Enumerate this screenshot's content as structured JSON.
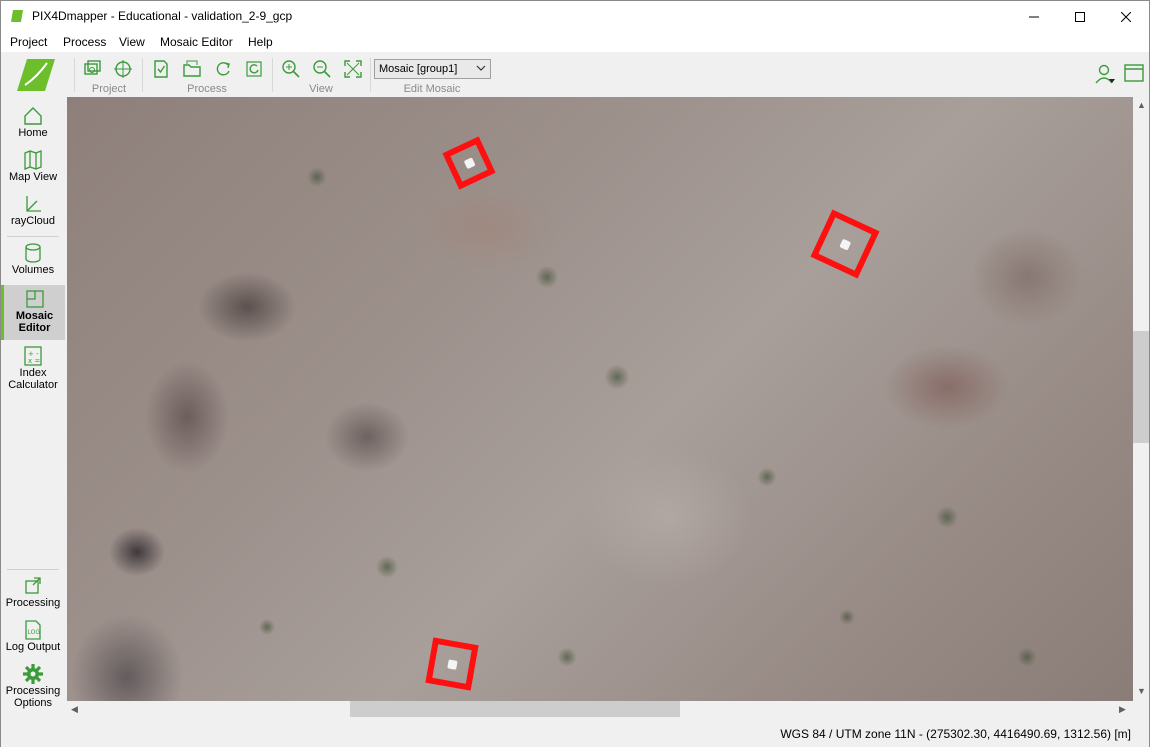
{
  "window": {
    "title": "PIX4Dmapper - Educational - validation_2-9_gcp",
    "brand_color": "#6cbf2a"
  },
  "menu": {
    "items": [
      {
        "label": "Project"
      },
      {
        "label": "Process"
      },
      {
        "label": "View"
      },
      {
        "label": "Mosaic Editor"
      },
      {
        "label": "Help"
      }
    ]
  },
  "toolbar": {
    "groups": [
      {
        "label": "Project",
        "icons": [
          "images-icon",
          "gcp-target-icon"
        ]
      },
      {
        "label": "Process",
        "icons": [
          "process-check-icon",
          "open-folder-icon",
          "reprocess-icon",
          "refresh-icon"
        ]
      },
      {
        "label": "View",
        "icons": [
          "zoom-in-icon",
          "zoom-out-icon",
          "fit-view-icon"
        ]
      },
      {
        "label": "Edit Mosaic",
        "icons": []
      }
    ],
    "mosaic_select": {
      "value": "Mosaic [group1]"
    }
  },
  "sidebar": {
    "items": [
      {
        "label": "Home",
        "icon": "home-icon"
      },
      {
        "label": "Map View",
        "icon": "map-icon"
      },
      {
        "label": "rayCloud",
        "icon": "raycloud-icon"
      },
      {
        "label": "Volumes",
        "icon": "volumes-icon"
      },
      {
        "label": "Mosaic Editor",
        "line1": "Mosaic",
        "line2": "Editor",
        "icon": "mosaic-editor-icon",
        "active": true
      },
      {
        "label": "Index Calculator",
        "line1": "Index",
        "line2": "Calculator",
        "icon": "index-calculator-icon"
      }
    ],
    "bottom_items": [
      {
        "label": "Processing",
        "icon": "processing-icon"
      },
      {
        "label": "Log Output",
        "icon": "log-output-icon"
      },
      {
        "label": "Processing Options",
        "line1": "Processing",
        "line2": "Options",
        "icon": "gear-icon"
      }
    ]
  },
  "map": {
    "marker_color": "#ff1010"
  },
  "status": {
    "text": "WGS 84 / UTM zone 11N - (275302.30, 4416490.69, 1312.56) [m]"
  }
}
